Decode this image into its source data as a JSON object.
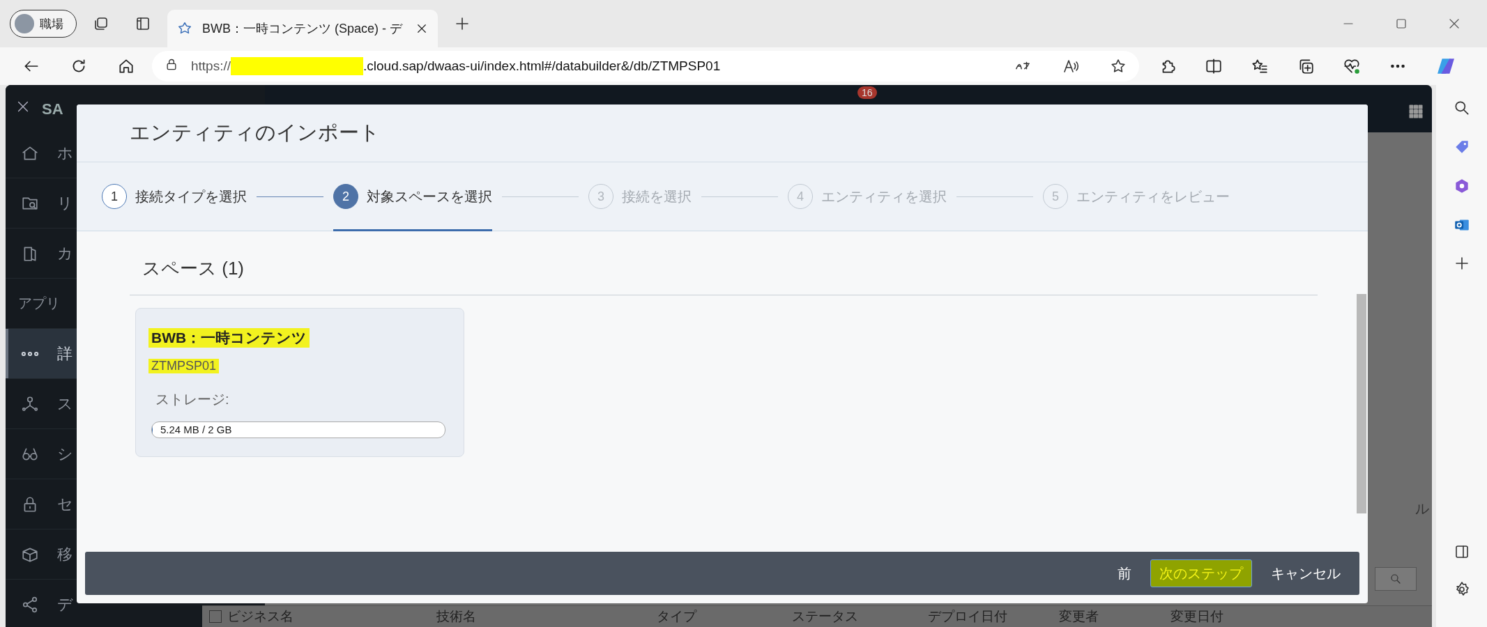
{
  "browser": {
    "profile": "職場",
    "tab_title": "BWB：一時コンテンツ (Space) - デ",
    "url_prefix": "https://",
    "url_redacted": true,
    "url_rest": ".cloud.sap/dwaas-ui/index.html#/databuilder&/db/ZTMPSP01"
  },
  "app": {
    "header": "SA",
    "badge": "16",
    "sidebar": [
      {
        "kind": "item",
        "label": "ホ",
        "selected": false
      },
      {
        "kind": "item",
        "label": "リ",
        "selected": false
      },
      {
        "kind": "item",
        "label": "カ",
        "selected": false
      },
      {
        "kind": "section",
        "label": "アプリ"
      },
      {
        "kind": "item",
        "label": "詳",
        "selected": true
      },
      {
        "kind": "item",
        "label": "ス",
        "selected": false
      },
      {
        "kind": "item",
        "label": "シ",
        "selected": false
      },
      {
        "kind": "item",
        "label": "セ",
        "selected": false
      },
      {
        "kind": "item",
        "label": "移",
        "selected": false
      },
      {
        "kind": "item",
        "label": "デ",
        "selected": false
      }
    ],
    "side_text": "ル",
    "table_checkbox": {
      "checked": false
    },
    "table_columns": [
      "ビジネス名",
      "技術名",
      "タイプ",
      "ステータス",
      "デプロイ日付",
      "変更者",
      "変更日付"
    ]
  },
  "dialog": {
    "title": "エンティティのインポート",
    "steps": [
      {
        "number": "1",
        "label": "接続タイプを選択",
        "selected": false,
        "disabled": false
      },
      {
        "number": "2",
        "label": "対象スペースを選択",
        "selected": true,
        "disabled": false
      },
      {
        "number": "3",
        "label": "接続を選択",
        "selected": false,
        "disabled": true
      },
      {
        "number": "4",
        "label": "エンティティを選択",
        "selected": false,
        "disabled": true
      },
      {
        "number": "5",
        "label": "エンティティをレビュー",
        "selected": false,
        "disabled": true
      }
    ],
    "section_title": "スペース (1)",
    "spaces": [
      {
        "name": "BWB：一時コンテンツ",
        "id": "ZTMPSP01",
        "highlighted": true,
        "storage_label": "ストレージ:",
        "storage": "5.24 MB / 2 GB",
        "level": 0.003
      }
    ],
    "buttons": [
      {
        "label": "前",
        "kind": "text",
        "highlighted": false
      },
      {
        "label": "次のステップ",
        "kind": "primary",
        "highlighted": true
      },
      {
        "label": "キャンセル",
        "kind": "text",
        "highlighted": false
      }
    ]
  }
}
